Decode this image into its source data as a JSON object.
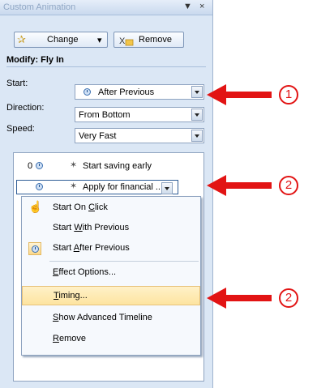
{
  "pane": {
    "title": "Custom Animation",
    "title_dropdown": "▼",
    "title_close": "×",
    "change_label": "Change",
    "change_dropdown": "▾",
    "remove_label": "Remove",
    "modify_label": "Modify: Fly In",
    "start": {
      "label": "Start:",
      "value": "After Previous"
    },
    "direction": {
      "label": "Direction:",
      "value": "From Bottom"
    },
    "speed": {
      "label": "Speed:",
      "value": "Very Fast"
    }
  },
  "list": {
    "items": [
      {
        "index": "0",
        "label": "Start saving early"
      },
      {
        "index": "",
        "label": "Apply for financial ..."
      }
    ]
  },
  "context_menu": {
    "items": [
      {
        "label": "Start On Click",
        "accel": "C"
      },
      {
        "label": "Start With Previous",
        "accel": "W"
      },
      {
        "label": "Start After Previous",
        "accel": "A"
      },
      {
        "label": "Effect Options...",
        "accel": "E"
      },
      {
        "label": "Timing...",
        "accel": "T"
      },
      {
        "label": "Show Advanced Timeline",
        "accel": "S"
      },
      {
        "label": "Remove",
        "accel": "R"
      }
    ],
    "highlighted": "Timing..."
  },
  "callouts": [
    "1",
    "2",
    "2"
  ],
  "colors": {
    "pane_bg": "#dbe7f5",
    "highlight": "#fde4a0",
    "arrow": "#e21414"
  }
}
